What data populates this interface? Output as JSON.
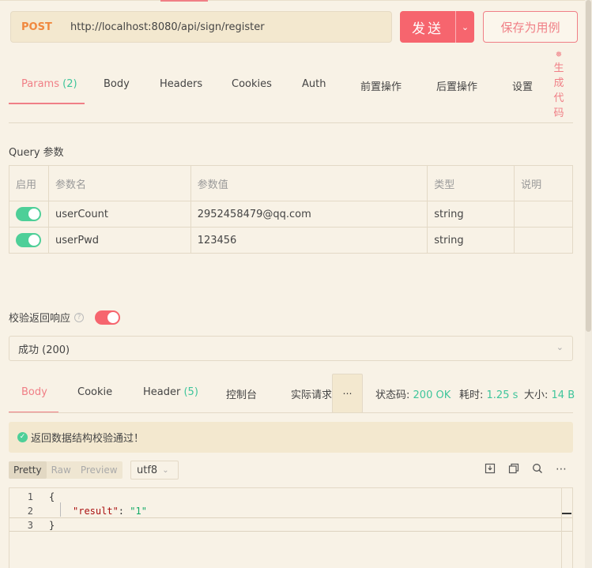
{
  "request": {
    "method": "POST",
    "url": "http://localhost:8080/api/sign/register",
    "send_label": "发送",
    "save_example_label": "保存为用例"
  },
  "request_tabs": [
    {
      "label": "Params",
      "count": "(2)",
      "active": true
    },
    {
      "label": "Body"
    },
    {
      "label": "Headers"
    },
    {
      "label": "Cookies"
    },
    {
      "label": "Auth"
    },
    {
      "label": "前置操作"
    },
    {
      "label": "后置操作"
    },
    {
      "label": "设置"
    }
  ],
  "generate_code_label": "生成代码",
  "query": {
    "title": "Query 参数",
    "headers": [
      "启用",
      "参数名",
      "参数值",
      "类型",
      "说明"
    ],
    "rows": [
      {
        "enabled": true,
        "name": "userCount",
        "value": "2952458479@qq.com",
        "type": "string",
        "desc": ""
      },
      {
        "enabled": true,
        "name": "userPwd",
        "value": "123456",
        "type": "string",
        "desc": ""
      }
    ]
  },
  "validation": {
    "label": "校验返回响应",
    "enabled": true,
    "selected_response": "成功 (200)"
  },
  "response_tabs": [
    {
      "label": "Body",
      "active": true
    },
    {
      "label": "Cookie"
    },
    {
      "label": "Header",
      "count": "(5)"
    },
    {
      "label": "控制台"
    },
    {
      "label": "实际请求"
    }
  ],
  "response_stats": {
    "status_label": "状态码:",
    "status_value": "200 OK",
    "time_label": "耗时:",
    "time_value": "1.25 s",
    "size_label": "大小:",
    "size_value": "14 B"
  },
  "validation_result": "返回数据结构校验通过！",
  "view_modes": [
    "Pretty",
    "Raw",
    "Preview"
  ],
  "encoding": "utf8",
  "code_lines": [
    {
      "num": "1",
      "text": "{"
    },
    {
      "num": "2",
      "key": "\"result\"",
      "sep": ": ",
      "val": "\"1\""
    },
    {
      "num": "3",
      "text": "}"
    }
  ],
  "colors": {
    "accent": "#f6656e",
    "success": "#3fc59b",
    "method": "#f0883e",
    "background": "#f8f2e6"
  }
}
